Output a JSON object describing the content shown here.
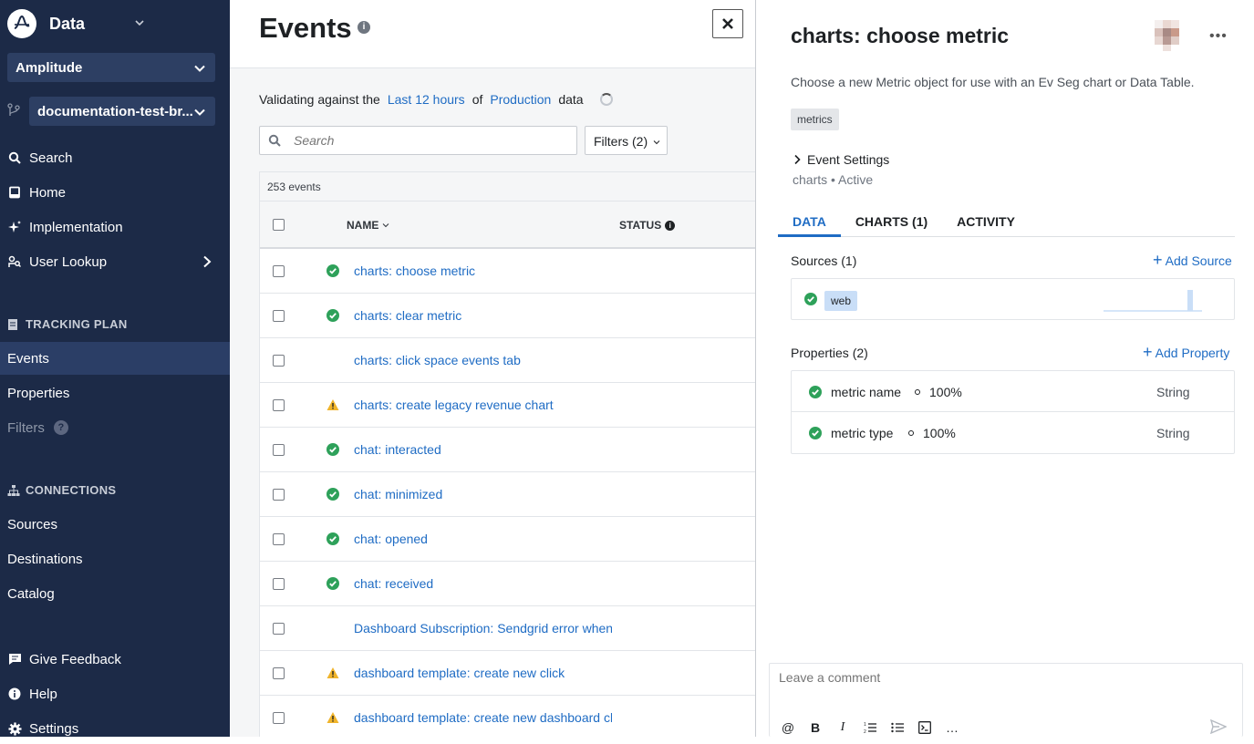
{
  "sidebar": {
    "app_title": "Data",
    "org_selector": "Amplitude",
    "branch_selector": "documentation-test-br...",
    "nav_top": [
      {
        "label": "Search",
        "icon": "search-icon"
      },
      {
        "label": "Home",
        "icon": "home-icon"
      },
      {
        "label": "Implementation",
        "icon": "sparkle-icon"
      },
      {
        "label": "User Lookup",
        "icon": "user-lookup-icon"
      }
    ],
    "tracking_plan_heading": "TRACKING PLAN",
    "tracking_plan_items": [
      "Events",
      "Properties",
      "Filters"
    ],
    "connections_heading": "CONNECTIONS",
    "connections_items": [
      "Sources",
      "Destinations",
      "Catalog"
    ],
    "footer_items": [
      {
        "label": "Give Feedback",
        "icon": "feedback-icon"
      },
      {
        "label": "Help",
        "icon": "help-icon"
      },
      {
        "label": "Settings",
        "icon": "gear-icon"
      }
    ],
    "colors": {
      "background": "#1c2a47",
      "active": "#2b3e66"
    }
  },
  "main": {
    "title": "Events",
    "validating": {
      "prefix": "Validating against the",
      "range": "Last 12 hours",
      "of": "of",
      "env": "Production",
      "suffix": "data"
    },
    "search_placeholder": "Search",
    "filters_label": "Filters (2)",
    "event_count": "253 events",
    "columns": {
      "name": "NAME",
      "status": "STATUS"
    },
    "rows": [
      {
        "name": "charts: choose metric",
        "status": "ok"
      },
      {
        "name": "charts: clear metric",
        "status": "ok"
      },
      {
        "name": "charts: click space events tab",
        "status": "none"
      },
      {
        "name": "charts: create legacy revenue chart",
        "status": "warn"
      },
      {
        "name": "chat: interacted",
        "status": "ok"
      },
      {
        "name": "chat: minimized",
        "status": "ok"
      },
      {
        "name": "chat: opened",
        "status": "ok"
      },
      {
        "name": "chat: received",
        "status": "ok"
      },
      {
        "name": "Dashboard Subscription: Sendgrid error when",
        "status": "none"
      },
      {
        "name": "dashboard template: create new click",
        "status": "warn"
      },
      {
        "name": "dashboard template: create new dashboard click",
        "status": "warn"
      }
    ]
  },
  "panel": {
    "title": "charts: choose metric",
    "description": "Choose a new Metric object for use with an Ev Seg chart or Data Table.",
    "tag": "metrics",
    "settings_label": "Event Settings",
    "category": "charts",
    "state": "Active",
    "tabs": [
      {
        "label": "DATA",
        "active": true
      },
      {
        "label": "CHARTS (1)",
        "active": false
      },
      {
        "label": "ACTIVITY",
        "active": false
      }
    ],
    "sources_heading": "Sources (1)",
    "add_source": "Add Source",
    "source_name": "web",
    "properties_heading": "Properties (2)",
    "add_property": "Add Property",
    "properties": [
      {
        "name": "metric name",
        "coverage": "100%",
        "type": "String"
      },
      {
        "name": "metric type",
        "coverage": "100%",
        "type": "String"
      }
    ],
    "comment_placeholder": "Leave a comment",
    "comment_tools": [
      "@",
      "B",
      "I",
      "ordered-list-icon",
      "bullet-list-icon",
      "code-icon",
      "…"
    ]
  },
  "colors": {
    "link": "#1f6cc4",
    "ok": "#2ea15a",
    "warn": "#f0b42b"
  }
}
